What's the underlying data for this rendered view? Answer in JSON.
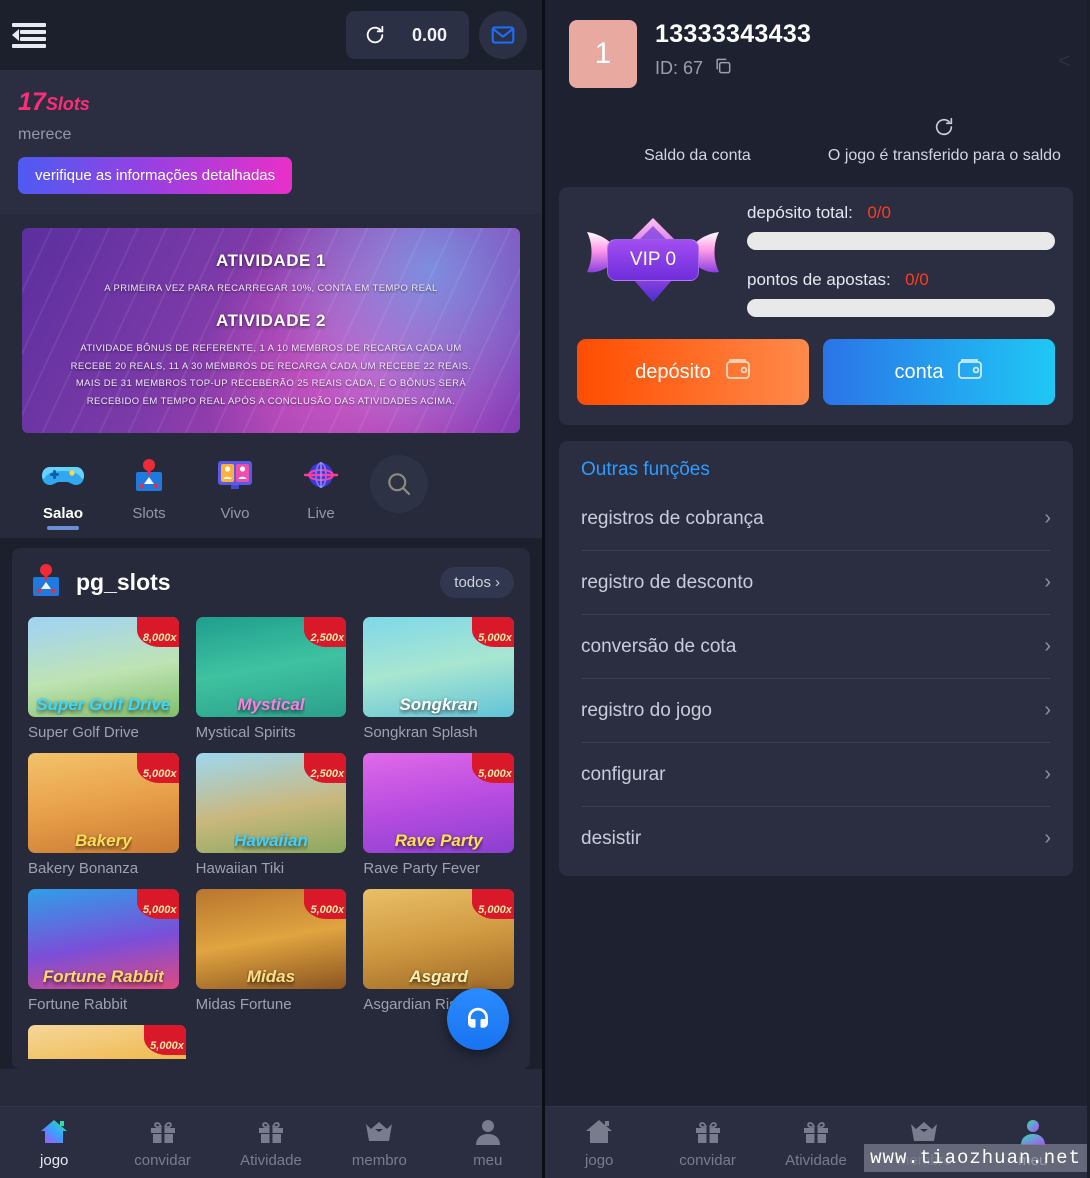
{
  "left": {
    "topbar": {
      "menu_icon": "hamburger-collapse-icon",
      "refresh_icon": "refresh-icon",
      "balance": "0.00",
      "mail_icon": "mail-icon"
    },
    "promo": {
      "title_number": "17",
      "title_word": "Slots",
      "subtitle": "merece",
      "button_label": "verifique as informações detalhadas"
    },
    "banner": {
      "heading1": "ATIVIDADE 1",
      "text1": "A PRIMEIRA VEZ PARA RECARREGAR 10%, CONTA EM TEMPO REAL",
      "heading2": "ATIVIDADE 2",
      "text2_line1": "ATIVIDADE BÔNUS DE REFERENTE, 1 A 10 MEMBROS DE RECARGA CADA UM",
      "text2_line2": "RECEBE 20 REALS, 11 A 30 MEMBROS DE RECARGA CADA UM RECEBE 22 REAIS.",
      "text2_line3": "MAIS DE 31 MEMBROS TOP-UP RECEBERÃO 25 REAIS CADA, E O BÔNUS SERÁ",
      "text2_line4": "RECEBIDO EM TEMPO REAL APÓS A CONCLUSÃO DAS ATIVIDADES ACIMA."
    },
    "categories": [
      {
        "label": "Salao",
        "icon": "gamepad-icon",
        "active": true
      },
      {
        "label": "Slots",
        "icon": "slot-machine-icon",
        "active": false
      },
      {
        "label": "Vivo",
        "icon": "live-monitor-icon",
        "active": false
      },
      {
        "label": "Live",
        "icon": "globe-icon",
        "active": false
      }
    ],
    "search_icon": "search-icon",
    "games_section": {
      "provider_icon": "slot-machine-icon",
      "provider": "pg_slots",
      "all_label": "todos",
      "all_chevron": "chevron-right-icon",
      "games": [
        {
          "name": "Super Golf Drive",
          "badge": "8,000x",
          "art": "Super Golf Drive"
        },
        {
          "name": "Mystical Spirits",
          "badge": "2,500x",
          "art": "Mystical"
        },
        {
          "name": "Songkran Splash",
          "badge": "5,000x",
          "art": "Songkran"
        },
        {
          "name": "Bakery Bonanza",
          "badge": "5,000x",
          "art": "Bakery"
        },
        {
          "name": "Hawaiian Tiki",
          "badge": "2,500x",
          "art": "Hawaiian"
        },
        {
          "name": "Rave Party Fever",
          "badge": "5,000x",
          "art": "Rave Party"
        },
        {
          "name": "Fortune Rabbit",
          "badge": "5,000x",
          "art": "Fortune Rabbit"
        },
        {
          "name": "Midas Fortune",
          "badge": "5,000x",
          "art": "Midas"
        },
        {
          "name": "Asgardian Rising",
          "badge": "5,000x",
          "art": "Asgard"
        }
      ],
      "partial_game": {
        "badge": "5,000x"
      }
    },
    "support_fab_icon": "headset-support-icon",
    "bottom_nav": [
      {
        "label": "jogo",
        "icon": "home-icon",
        "active": true
      },
      {
        "label": "convidar",
        "icon": "gift-icon",
        "active": false
      },
      {
        "label": "Atividade",
        "icon": "gift-icon",
        "active": false
      },
      {
        "label": "membro",
        "icon": "crown-icon",
        "active": false
      },
      {
        "label": "meu",
        "icon": "person-icon",
        "active": false
      }
    ]
  },
  "right": {
    "account": {
      "avatar_initial": "1",
      "username": "13333343433",
      "id_label": "ID: 67",
      "copy_icon": "copy-icon",
      "back_icon": "chevron-left-icon"
    },
    "balance": {
      "account_balance_label": "Saldo da conta",
      "transfer_icon": "refresh-icon",
      "transfer_label": "O jogo é transferido para o saldo"
    },
    "vip": {
      "badge_label": "VIP 0",
      "crest_icon": "vip-crest-icon",
      "deposit_label": "depósito total:",
      "deposit_value": "0/0",
      "points_label": "pontos de apostas:",
      "points_value": "0/0",
      "deposit_button": "depósito",
      "deposit_button_icon": "wallet-icon",
      "account_button": "conta",
      "account_button_icon": "wallet-icon"
    },
    "functions": {
      "title": "Outras funções",
      "items": [
        {
          "label": "registros de cobrança"
        },
        {
          "label": "registro de desconto"
        },
        {
          "label": "conversão de cota"
        },
        {
          "label": "registro do jogo"
        },
        {
          "label": "configurar"
        },
        {
          "label": "desistir"
        }
      ]
    },
    "bottom_nav": [
      {
        "label": "jogo",
        "icon": "home-icon",
        "active": false
      },
      {
        "label": "convidar",
        "icon": "gift-icon",
        "active": false
      },
      {
        "label": "Atividade",
        "icon": "gift-icon",
        "active": false
      },
      {
        "label": "membro",
        "icon": "crown-icon",
        "active": false
      },
      {
        "label": "meu",
        "icon": "person-icon",
        "active": true
      }
    ],
    "watermark": "www.tiaozhuan.net"
  },
  "colors": {
    "accent_pink": "#ff2d78",
    "accent_blue": "#2e9cff",
    "deposit_orange": "#ff4d00",
    "account_blue": "#2a74e8",
    "value_red": "#ff3b20",
    "panel_bg": "#262a3b",
    "right_bg": "#1e2130"
  }
}
